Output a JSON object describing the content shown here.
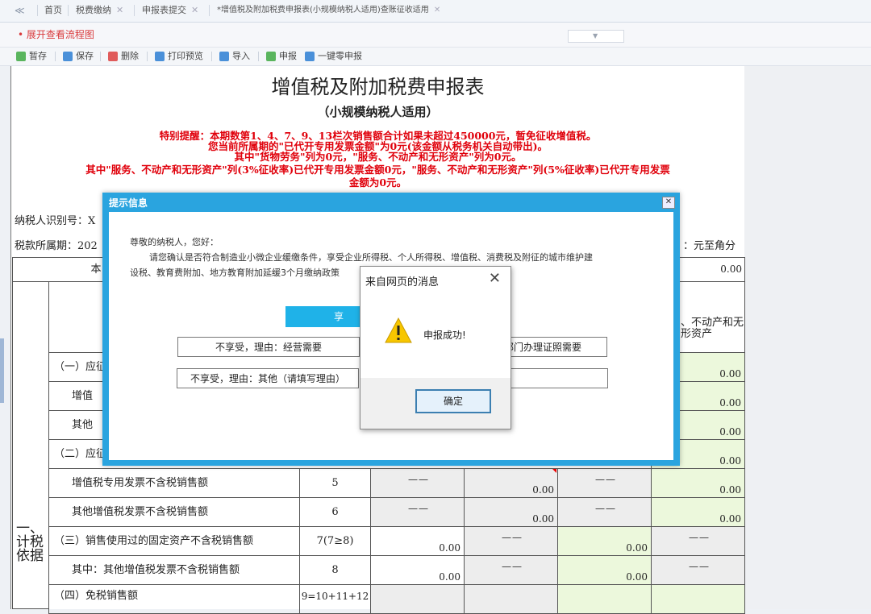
{
  "tabs": {
    "nav": "≪",
    "items": [
      {
        "label": "首页"
      },
      {
        "label": "税费缴纳",
        "close": "✕"
      },
      {
        "label": "申报表提交",
        "close": "✕"
      },
      {
        "label": "*增值税及附加税费申报表(小规模纳税人适用)查账征收适用",
        "close": "✕"
      }
    ]
  },
  "flow": {
    "link": "• 展开查看流程图",
    "dropdown_arrow": "▼"
  },
  "toolbar": {
    "items": [
      {
        "label": "暂存",
        "icon": "check-icon",
        "color": "#5ab55e"
      },
      {
        "label": "保存",
        "icon": "save-icon",
        "color": "#4a90d9"
      },
      {
        "label": "删除",
        "icon": "delete-icon",
        "color": "#e05b5b"
      },
      {
        "label": "打印预览",
        "icon": "print-icon",
        "color": "#4a90d9"
      },
      {
        "label": "导入",
        "icon": "import-icon",
        "color": "#4a90d9"
      },
      {
        "label": "申报",
        "icon": "check-icon",
        "color": "#5ab55e"
      },
      {
        "label": "一键零申报",
        "icon": "zero-icon",
        "color": "#4a90d9"
      }
    ]
  },
  "form": {
    "title": "增值税及附加税费申报表",
    "subtitle": "（小规模纳税人适用）",
    "notice": [
      "特别提醒：本期数第1、4、7、9、13栏次销售额合计如果未超过450000元，暂免征收增值税。",
      "您当前所属期的\"已代开专用发票金额\"为0元(该金额从税务机关自动带出)。",
      "其中\"货物劳务\"列为0元，\"服务、不动产和无形资产\"列为0元。",
      "其中\"服务、不动产和无形资产\"列(3%征收率)已代开专用发票金额0元，\"服务、不动产和无形资产\"列(5%征收率)已代开专用发票",
      "金额为0元。"
    ],
    "taxpayer_id_label": "纳税人识别号：X",
    "period_label": "税款所属期：202",
    "unit_label": "：元至角分"
  },
  "table": {
    "row0": {
      "label": "本",
      "value": "0.00"
    },
    "col_header_partial": "、不动产和无形资产",
    "section_label": "一、计税依据",
    "rows": [
      {
        "label": "（一）应征",
        "value": "0.00"
      },
      {
        "label": "增值",
        "value": "0.00"
      },
      {
        "label": "其他",
        "value": "0.00"
      },
      {
        "label": "（二）应征",
        "value": "0.00"
      },
      {
        "label": "增值税专用发票不含税销售额",
        "no": "5",
        "c1": "——",
        "c2": "0.00",
        "c3": "——",
        "c4": "0.00"
      },
      {
        "label": "其他增值税发票不含税销售额",
        "no": "6",
        "c1": "——",
        "c2": "0.00",
        "c3": "——",
        "c4": "0.00"
      },
      {
        "label": "（三）销售使用过的固定资产不含税销售额",
        "no": "7(7≥8)",
        "c1": "0.00",
        "c2": "——",
        "c3": "0.00",
        "c4": "——"
      },
      {
        "label": "其中：其他增值税发票不含税销售额",
        "no": "8",
        "c1": "0.00",
        "c2": "——",
        "c3": "0.00",
        "c4": "——"
      },
      {
        "label": "（四）免税销售额",
        "no": "9=10+11+12"
      }
    ]
  },
  "prompt": {
    "title": "提示信息",
    "close": "✕",
    "greeting": "尊敬的纳税人，您好：",
    "line1": "请您确认是否符合制造业小微企业缓缴条件，享受企业所得税、个人所得税、增值税、消费税及附征的城市维护建",
    "line2": "设税、教育费附加、地方教育附加延缓3个月缴纳政策",
    "enjoy": "享",
    "reason1": "不享受，理由：经营需要",
    "reason2": "部门办理证照需要",
    "reason3": "不享受，理由：其他（请填写理由）"
  },
  "alert": {
    "title": "来自网页的消息",
    "close": "✕",
    "message": "申报成功!",
    "ok": "确定"
  }
}
